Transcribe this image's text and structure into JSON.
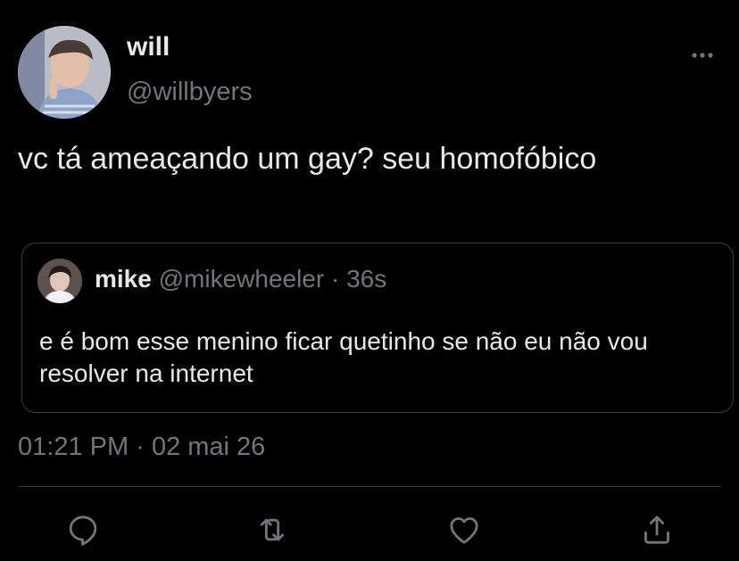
{
  "author": {
    "name": "will",
    "handle": "@willbyers"
  },
  "tweet": {
    "text": "vc tá ameaçando um gay? seu homofóbico",
    "time": "01:21 PM",
    "separator": "·",
    "date": "02 mai 26"
  },
  "quote": {
    "name": "mike",
    "handle": "@mikewheeler",
    "separator": "·",
    "time": "36s",
    "text": "e é bom esse menino ficar quetinho se não eu não vou resolver na internet"
  },
  "icons": {
    "more": "more-horizontal-icon",
    "reply": "reply-icon",
    "retweet": "retweet-icon",
    "like": "like-heart-icon",
    "share": "share-icon"
  },
  "colors": {
    "background": "#000000",
    "primary_text": "#e7e9ea",
    "secondary_text": "#71767b",
    "border": "#3b3f44"
  }
}
